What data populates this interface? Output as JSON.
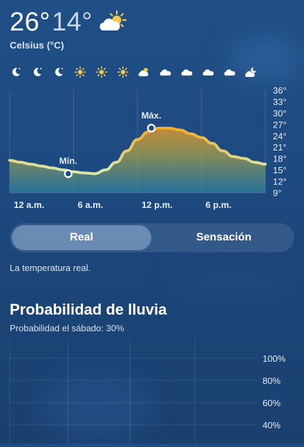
{
  "current": {
    "high": "26°",
    "low": "14°",
    "unit_label": "Celsius (°C)",
    "icon": "partly-sunny-icon"
  },
  "hourly_icons": [
    "moon-icon",
    "moon-icon",
    "moon-icon",
    "sun-icon",
    "sun-icon",
    "sun-icon",
    "partly-sunny-icon",
    "cloud-icon",
    "cloud-icon",
    "cloud-icon",
    "cloud-icon",
    "partly-cloudy-night-icon"
  ],
  "chart_data": [
    {
      "type": "line",
      "x_ticks": [
        "12 a.m.",
        "6 a.m.",
        "12 p.m.",
        "6 p.m."
      ],
      "y_ticks": [
        "36°",
        "33°",
        "30°",
        "27°",
        "24°",
        "21°",
        "18°",
        "15°",
        "12°",
        "9°"
      ],
      "ylim": [
        9,
        36
      ],
      "x": [
        0,
        1,
        2,
        3,
        4,
        5,
        6,
        7,
        8,
        9,
        10,
        11,
        12,
        13,
        14,
        15,
        16,
        17,
        18,
        19,
        20,
        21,
        22,
        23,
        24
      ],
      "values": [
        17.5,
        17,
        16.5,
        16,
        15.5,
        15,
        14.5,
        14.2,
        14,
        15,
        17,
        20,
        23,
        25,
        26,
        26,
        25.5,
        24.5,
        23.5,
        22,
        20,
        18.5,
        18,
        17,
        16.5
      ],
      "min": {
        "label": "Mín.",
        "x": 5.5,
        "value": 14
      },
      "max": {
        "label": "Máx.",
        "x": 13.3,
        "value": 26
      }
    },
    {
      "type": "bar",
      "y_ticks": [
        "100%",
        "80%",
        "60%",
        "40%"
      ],
      "ylim": [
        0,
        100
      ],
      "values": []
    }
  ],
  "toggle": {
    "real": "Real",
    "feels": "Sensación"
  },
  "description": "La temperatura real.",
  "rain": {
    "title": "Probabilidad de lluvia",
    "subtitle": "Probabilidad el sábado: 30%"
  },
  "colors": {
    "background": "#1d4a80",
    "line_hot": "#f5a623",
    "line_cool": "#d9e7a8",
    "toggle_active": "#8fb0d6"
  }
}
